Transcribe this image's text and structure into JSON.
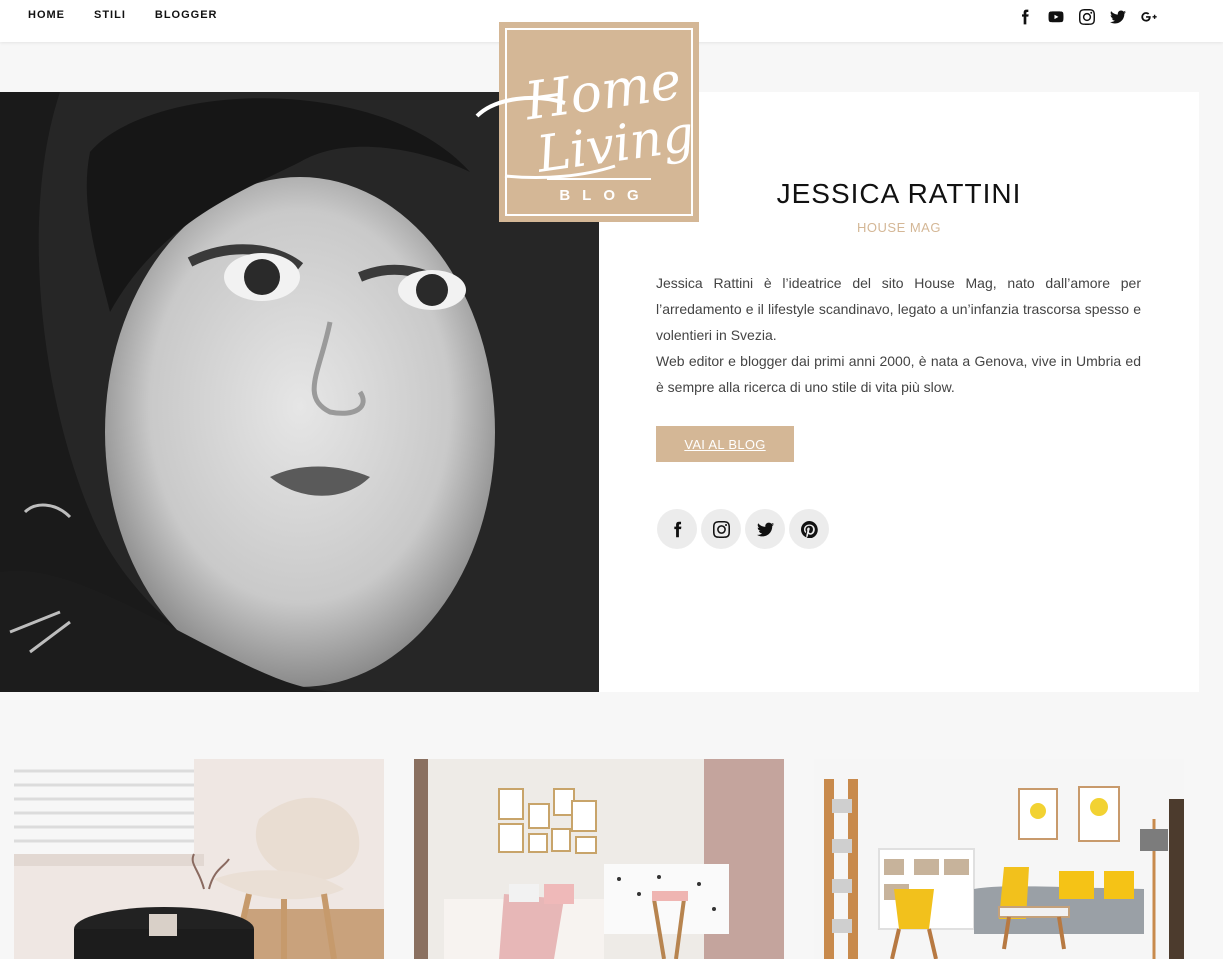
{
  "nav": {
    "items": [
      {
        "label": "HOME"
      },
      {
        "label": "STILI"
      },
      {
        "label": "BLOGGER"
      }
    ]
  },
  "header_social": [
    "facebook-icon",
    "youtube-icon",
    "instagram-icon",
    "twitter-icon",
    "google-plus-icon"
  ],
  "logo": {
    "script_line1": "Home",
    "script_line2": "Living",
    "blog": "BLOG",
    "color": "#d4b796"
  },
  "profile": {
    "name": "JESSICA RATTINI",
    "subtitle": "HOUSE MAG",
    "bio_1": "Jessica Rattini è l’ideatrice del sito House Mag, nato dall’amore per l’arredamento e il lifestyle scandinavo, legato a un’infanzia trascorsa spesso e volentieri in Svezia.",
    "bio_2": "Web editor e blogger dai primi anni 2000, è nata a Genova, vive in Umbria ed è sempre alla ricerca di uno stile di vita più slow.",
    "button_label": "VAI AL BLOG",
    "social": [
      "facebook-icon",
      "instagram-icon",
      "twitter-icon",
      "pinterest-icon"
    ]
  },
  "colors": {
    "accent": "#d4b796",
    "background": "#f7f7f7",
    "text": "#111111"
  }
}
